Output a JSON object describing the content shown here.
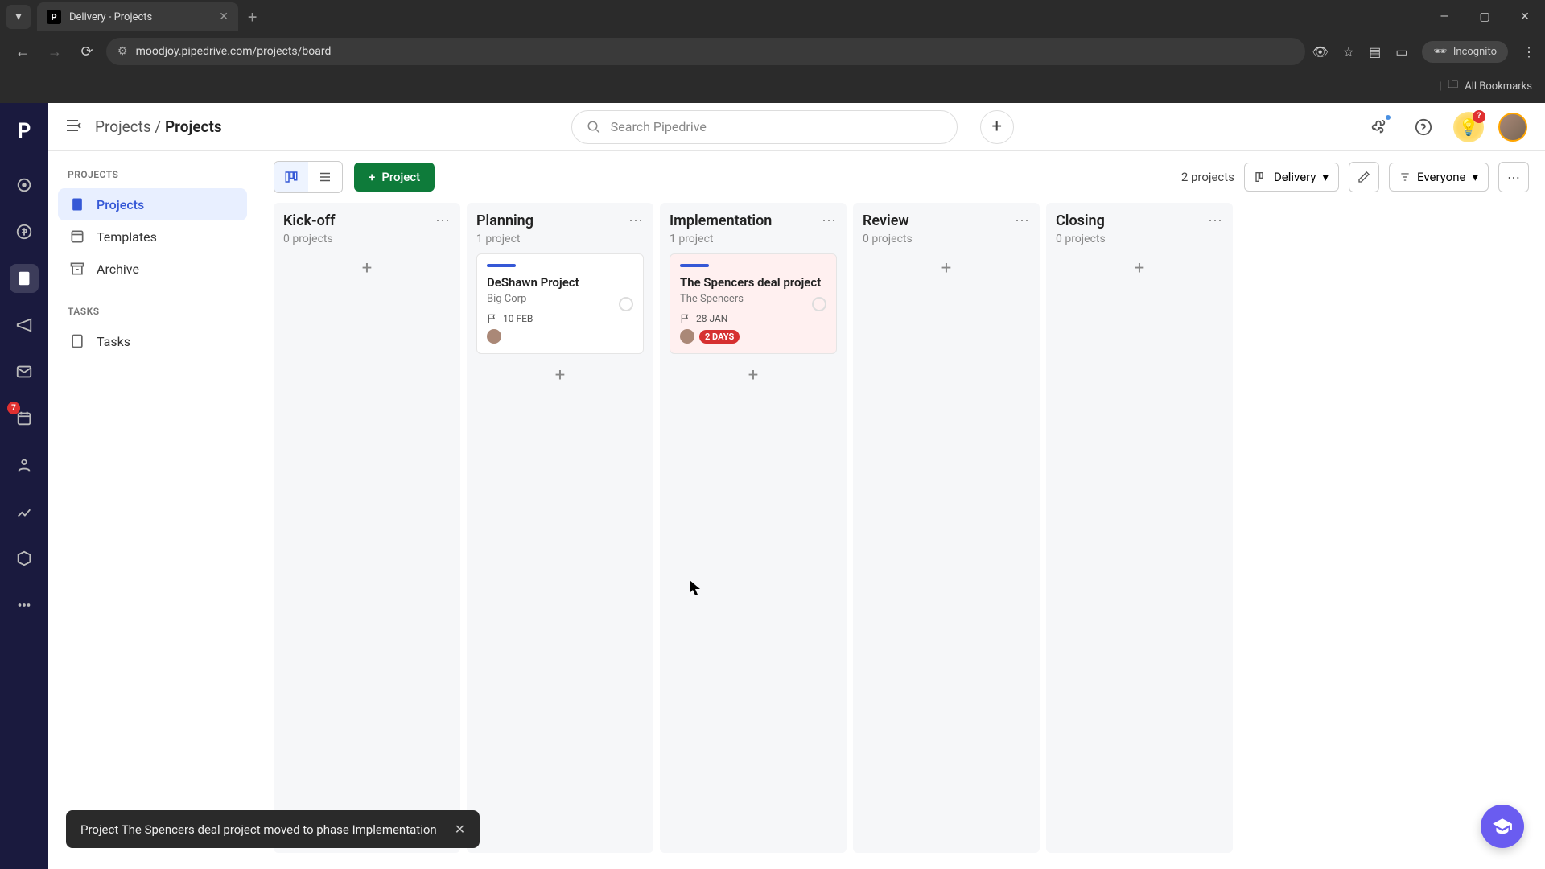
{
  "browser": {
    "tab_title": "Delivery - Projects",
    "url": "moodjoy.pipedrive.com/projects/board",
    "incognito_label": "Incognito",
    "bookmarks_label": "All Bookmarks"
  },
  "rail": {
    "badge_count": "7"
  },
  "header": {
    "breadcrumb_root": "Projects",
    "breadcrumb_current": "Projects",
    "search_placeholder": "Search Pipedrive",
    "bulb_badge": "?"
  },
  "sidebar": {
    "group1_heading": "PROJECTS",
    "items1": [
      {
        "label": "Projects",
        "active": true
      },
      {
        "label": "Templates",
        "active": false
      },
      {
        "label": "Archive",
        "active": false
      }
    ],
    "group2_heading": "TASKS",
    "items2": [
      {
        "label": "Tasks",
        "active": false
      }
    ]
  },
  "toolbar": {
    "new_project_label": "Project",
    "count_text": "2 projects",
    "board_dropdown": "Delivery",
    "filter_dropdown": "Everyone"
  },
  "columns": [
    {
      "title": "Kick-off",
      "count": "0 projects",
      "cards": []
    },
    {
      "title": "Planning",
      "count": "1 project",
      "cards": [
        {
          "title": "DeShawn Project",
          "subtitle": "Big Corp",
          "date": "10 FEB",
          "badge": "",
          "overdue": false
        }
      ]
    },
    {
      "title": "Implementation",
      "count": "1 project",
      "cards": [
        {
          "title": "The Spencers deal project",
          "subtitle": "The Spencers",
          "date": "28 JAN",
          "badge": "2 DAYS",
          "overdue": true
        }
      ]
    },
    {
      "title": "Review",
      "count": "0 projects",
      "cards": []
    },
    {
      "title": "Closing",
      "count": "0 projects",
      "cards": []
    }
  ],
  "toast": {
    "message": "Project The Spencers deal project moved to phase Implementation"
  }
}
